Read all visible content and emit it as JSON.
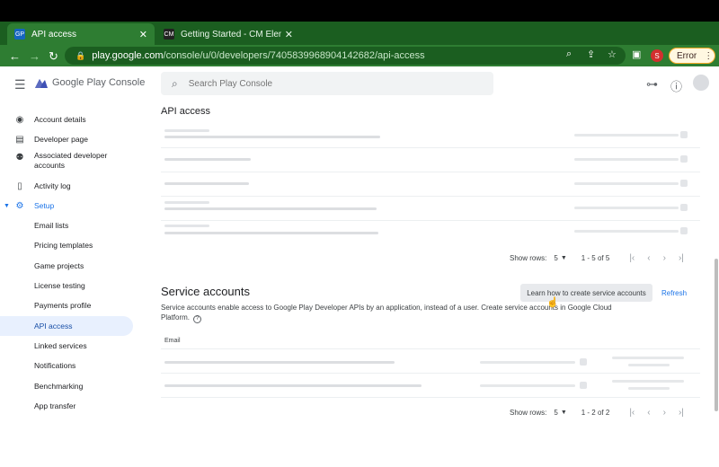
{
  "browser": {
    "tabs": [
      {
        "title": "API access",
        "favicon": "GP",
        "active": true
      },
      {
        "title": "Getting Started - CM Elements",
        "favicon": "CM",
        "active": false
      }
    ],
    "url_domain": "play.google.com",
    "url_path": "/console/u/0/developers/7405839968904142682/api-access",
    "profile_initial": "S",
    "error_label": "Error",
    "colors": {
      "frame": "#1b5e20",
      "toolbar": "#2e7d32"
    }
  },
  "header": {
    "brand": "Google Play Console",
    "search_placeholder": "Search Play Console"
  },
  "sidebar": {
    "items": [
      {
        "label": "Account details",
        "icon": "account-circle-icon"
      },
      {
        "label": "Developer page",
        "icon": "web-page-icon"
      },
      {
        "label": "Associated developer accounts",
        "icon": "group-icon"
      },
      {
        "label": "Activity log",
        "icon": "document-icon"
      },
      {
        "label": "Setup",
        "icon": "gear-icon"
      },
      {
        "label": "Email lists"
      },
      {
        "label": "Pricing templates"
      },
      {
        "label": "Game projects"
      },
      {
        "label": "License testing"
      },
      {
        "label": "Payments profile"
      },
      {
        "label": "API access"
      },
      {
        "label": "Linked services"
      },
      {
        "label": "Notifications"
      },
      {
        "label": "Benchmarking"
      },
      {
        "label": "App transfer"
      }
    ],
    "active": "API access"
  },
  "main": {
    "title": "API access",
    "projects_pager": {
      "show_rows_label": "Show rows:",
      "rows": "5",
      "range": "1 - 5 of 5"
    },
    "service_accounts": {
      "title": "Service accounts",
      "learn_button": "Learn how to create service accounts",
      "refresh_button": "Refresh",
      "description": "Service accounts enable access to Google Play Developer APIs by an application, instead of a user. Create service accounts in Google Cloud Platform.",
      "email_header": "Email",
      "pager": {
        "show_rows_label": "Show rows:",
        "rows": "5",
        "range": "1 - 2 of 2"
      }
    }
  }
}
